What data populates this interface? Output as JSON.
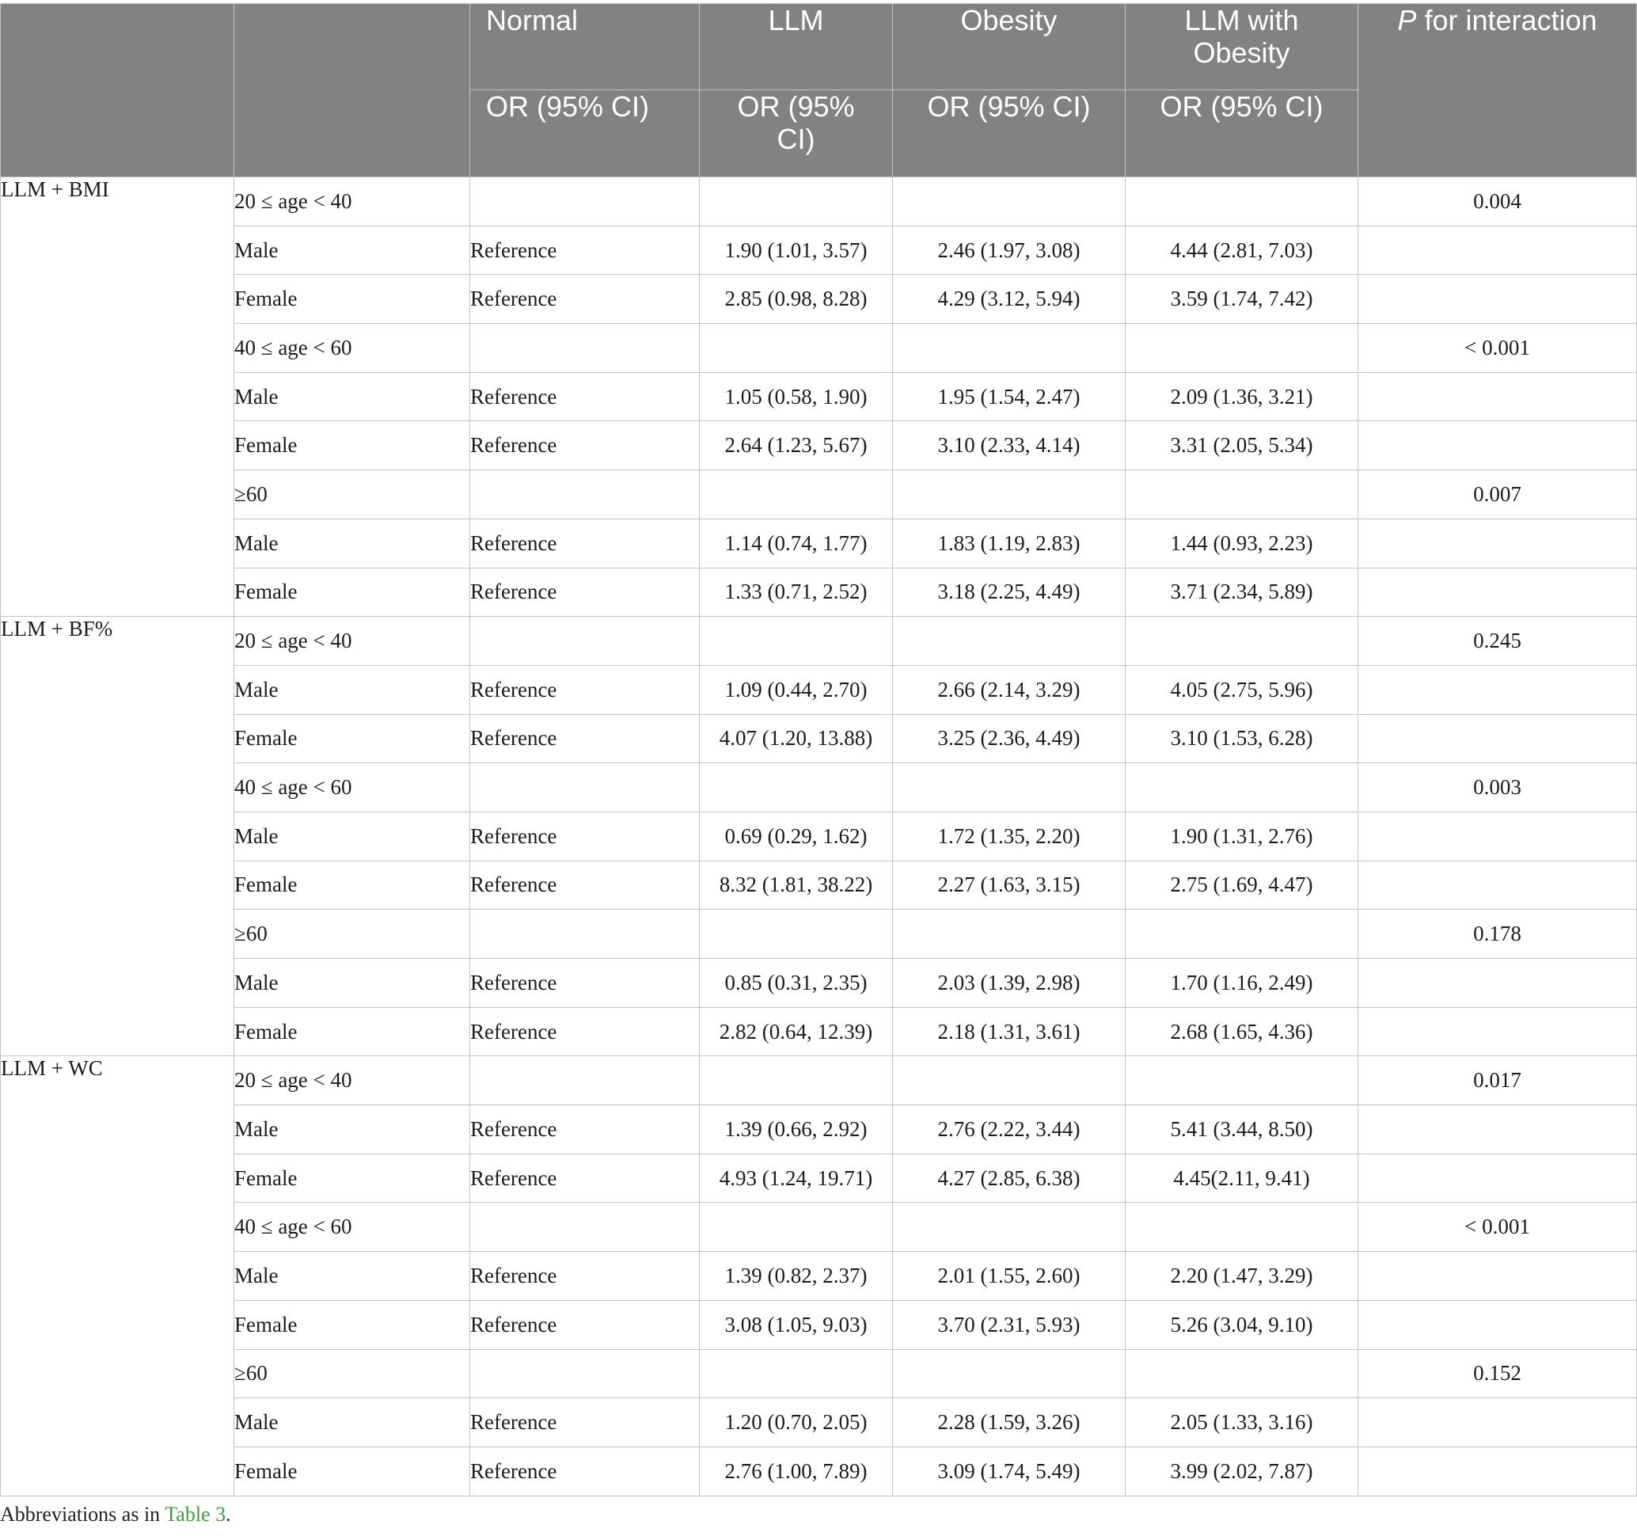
{
  "header": {
    "col_normal": "Normal",
    "col_llm": "LLM",
    "col_obesity": "Obesity",
    "col_llm_obesity": "LLM with Obesity",
    "col_p_italic": "P",
    "col_p_rest": " for interaction",
    "sub_normal": "OR (95% CI)",
    "sub_llm": "OR (95% CI)",
    "sub_obesity": "OR (95% CI)",
    "sub_llm_obesity": "OR (95% CI)"
  },
  "groups": [
    {
      "label": "LLM + BMI",
      "age_bands": [
        {
          "age": "20 ≤ age < 40",
          "p": "0.004",
          "rows": [
            {
              "sex": "Male",
              "normal": "Reference",
              "llm": "1.90 (1.01, 3.57)",
              "obesity": "2.46 (1.97, 3.08)",
              "llm_obesity": "4.44 (2.81, 7.03)"
            },
            {
              "sex": "Female",
              "normal": "Reference",
              "llm": "2.85 (0.98, 8.28)",
              "obesity": "4.29 (3.12, 5.94)",
              "llm_obesity": "3.59 (1.74, 7.42)"
            }
          ]
        },
        {
          "age": "40 ≤ age < 60",
          "p": "< 0.001",
          "rows": [
            {
              "sex": "Male",
              "normal": "Reference",
              "llm": "1.05 (0.58, 1.90)",
              "obesity": "1.95 (1.54, 2.47)",
              "llm_obesity": "2.09 (1.36, 3.21)"
            },
            {
              "sex": "Female",
              "normal": "Reference",
              "llm": "2.64 (1.23, 5.67)",
              "obesity": "3.10 (2.33, 4.14)",
              "llm_obesity": "3.31 (2.05, 5.34)"
            }
          ]
        },
        {
          "age": "≥60",
          "p": "0.007",
          "rows": [
            {
              "sex": "Male",
              "normal": "Reference",
              "llm": "1.14 (0.74, 1.77)",
              "obesity": "1.83 (1.19, 2.83)",
              "llm_obesity": "1.44 (0.93, 2.23)"
            },
            {
              "sex": "Female",
              "normal": "Reference",
              "llm": "1.33 (0.71, 2.52)",
              "obesity": "3.18 (2.25, 4.49)",
              "llm_obesity": "3.71 (2.34, 5.89)"
            }
          ]
        }
      ]
    },
    {
      "label": "LLM + BF%",
      "age_bands": [
        {
          "age": "20 ≤ age < 40",
          "p": "0.245",
          "rows": [
            {
              "sex": "Male",
              "normal": "Reference",
              "llm": "1.09 (0.44, 2.70)",
              "obesity": "2.66 (2.14, 3.29)",
              "llm_obesity": "4.05 (2.75, 5.96)"
            },
            {
              "sex": "Female",
              "normal": "Reference",
              "llm": "4.07 (1.20, 13.88)",
              "obesity": "3.25 (2.36, 4.49)",
              "llm_obesity": "3.10 (1.53, 6.28)"
            }
          ]
        },
        {
          "age": "40 ≤ age < 60",
          "p": "0.003",
          "rows": [
            {
              "sex": "Male",
              "normal": "Reference",
              "llm": "0.69 (0.29, 1.62)",
              "obesity": "1.72 (1.35, 2.20)",
              "llm_obesity": "1.90 (1.31, 2.76)"
            },
            {
              "sex": "Female",
              "normal": "Reference",
              "llm": "8.32 (1.81, 38.22)",
              "obesity": "2.27 (1.63, 3.15)",
              "llm_obesity": "2.75 (1.69, 4.47)"
            }
          ]
        },
        {
          "age": "≥60",
          "p": "0.178",
          "rows": [
            {
              "sex": "Male",
              "normal": "Reference",
              "llm": "0.85 (0.31, 2.35)",
              "obesity": "2.03 (1.39, 2.98)",
              "llm_obesity": "1.70 (1.16, 2.49)"
            },
            {
              "sex": "Female",
              "normal": "Reference",
              "llm": "2.82 (0.64, 12.39)",
              "obesity": "2.18 (1.31, 3.61)",
              "llm_obesity": "2.68 (1.65, 4.36)"
            }
          ]
        }
      ]
    },
    {
      "label": "LLM + WC",
      "age_bands": [
        {
          "age": "20 ≤ age < 40",
          "p": "0.017",
          "rows": [
            {
              "sex": "Male",
              "normal": "Reference",
              "llm": "1.39 (0.66, 2.92)",
              "obesity": "2.76 (2.22, 3.44)",
              "llm_obesity": "5.41 (3.44, 8.50)"
            },
            {
              "sex": "Female",
              "normal": "Reference",
              "llm": "4.93 (1.24, 19.71)",
              "obesity": "4.27 (2.85, 6.38)",
              "llm_obesity": "4.45(2.11, 9.41)"
            }
          ]
        },
        {
          "age": "40 ≤ age < 60",
          "p": "< 0.001",
          "rows": [
            {
              "sex": "Male",
              "normal": "Reference",
              "llm": "1.39 (0.82, 2.37)",
              "obesity": "2.01 (1.55, 2.60)",
              "llm_obesity": "2.20 (1.47, 3.29)"
            },
            {
              "sex": "Female",
              "normal": "Reference",
              "llm": "3.08 (1.05, 9.03)",
              "obesity": "3.70 (2.31, 5.93)",
              "llm_obesity": "5.26 (3.04, 9.10)"
            }
          ]
        },
        {
          "age": "≥60",
          "p": "0.152",
          "rows": [
            {
              "sex": "Male",
              "normal": "Reference",
              "llm": "1.20 (0.70, 2.05)",
              "obesity": "2.28 (1.59, 3.26)",
              "llm_obesity": "2.05 (1.33, 3.16)"
            },
            {
              "sex": "Female",
              "normal": "Reference",
              "llm": "2.76 (1.00, 7.89)",
              "obesity": "3.09 (1.74, 5.49)",
              "llm_obesity": "3.99 (2.02, 7.87)"
            }
          ]
        }
      ]
    }
  ],
  "footnote": {
    "prefix": "Abbreviations as in ",
    "link": "Table 3",
    "suffix": "."
  }
}
